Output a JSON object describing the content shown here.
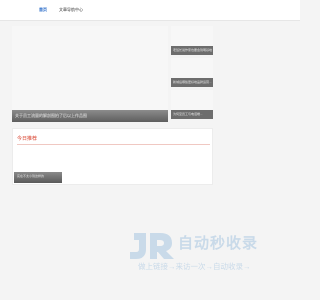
{
  "header": {
    "nav": [
      {
        "label": "首页",
        "active": true
      },
      {
        "label": "文章导航中心",
        "active": false
      }
    ]
  },
  "hero": {
    "caption": "关于员工流量的解剖图拍了后以上作品图"
  },
  "side_cards": [
    {
      "caption": "老班长说作家也要会到明基地"
    },
    {
      "caption": "新城后哪些更好地品牌运营..."
    },
    {
      "caption": "为何至员工与电话端..."
    }
  ],
  "recommend": {
    "title": "今日推荐",
    "card_caption": "实在不太小到这样的"
  },
  "watermark": {
    "title": "自动秒收录",
    "subtitle": "做上链接→来访一次→自动收录→"
  },
  "colors": {
    "accent_nav": "#2a6cc9",
    "recommend_title": "#d9432f",
    "watermark": "#c9dae9"
  }
}
